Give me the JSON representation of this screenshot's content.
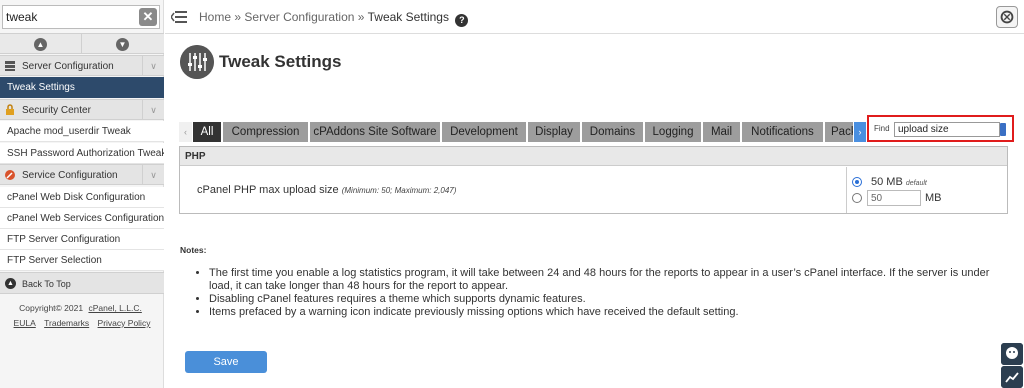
{
  "sidebar": {
    "search_value": "tweak",
    "items": [
      {
        "label": "Server Configuration",
        "type": "category"
      },
      {
        "label": "Tweak Settings",
        "type": "active"
      },
      {
        "label": "Security Center",
        "type": "category"
      },
      {
        "label": "Apache mod_userdir Tweak",
        "type": "link"
      },
      {
        "label": "SSH Password Authorization Tweak",
        "type": "link"
      },
      {
        "label": "Service Configuration",
        "type": "category"
      },
      {
        "label": "cPanel Web Disk Configuration",
        "type": "link"
      },
      {
        "label": "cPanel Web Services Configuration",
        "type": "link"
      },
      {
        "label": "FTP Server Configuration",
        "type": "link"
      },
      {
        "label": "FTP Server Selection",
        "type": "link"
      }
    ],
    "back_to_top": "Back To Top",
    "copyright": "Copyright© 2021",
    "copyright_link": "cPanel, L.L.C.",
    "footer_links": [
      "EULA",
      "Trademarks",
      "Privacy Policy"
    ]
  },
  "breadcrumb": {
    "home": "Home",
    "sep": "»",
    "parent": "Server Configuration",
    "current": "Tweak Settings"
  },
  "page": {
    "title": "Tweak Settings"
  },
  "tabs": [
    "All",
    "Compression",
    "cPAddons Site Software",
    "Development",
    "Display",
    "Domains",
    "Logging",
    "Mail",
    "Notifications",
    "Pack"
  ],
  "find": {
    "label": "Find",
    "value": "upload size"
  },
  "panel": {
    "heading": "PHP",
    "setting_label": "cPanel PHP max upload size",
    "setting_hint": "(Minimum: 50; Maximum: 2,047)",
    "option_default": "50 MB",
    "option_default_tag": "default",
    "custom_value": "50",
    "unit": "MB"
  },
  "notes": {
    "title": "Notes",
    "items": [
      "The first time you enable a log statistics program, it will take between 24 and 48 hours for the reports to appear in a user’s cPanel interface. If the server is under load, it can take longer than 48 hours for the report to appear.",
      "Disabling cPanel features requires a theme which supports dynamic features.",
      "Items prefaced by a warning icon indicate previously missing options which have received the default setting."
    ]
  },
  "actions": {
    "save_label": "Save"
  },
  "colors": {
    "sidebar_active": "#2d4a6b",
    "tab_active": "#333333",
    "save_button": "#4a8fd9",
    "find_highlight": "#e01c1c"
  }
}
